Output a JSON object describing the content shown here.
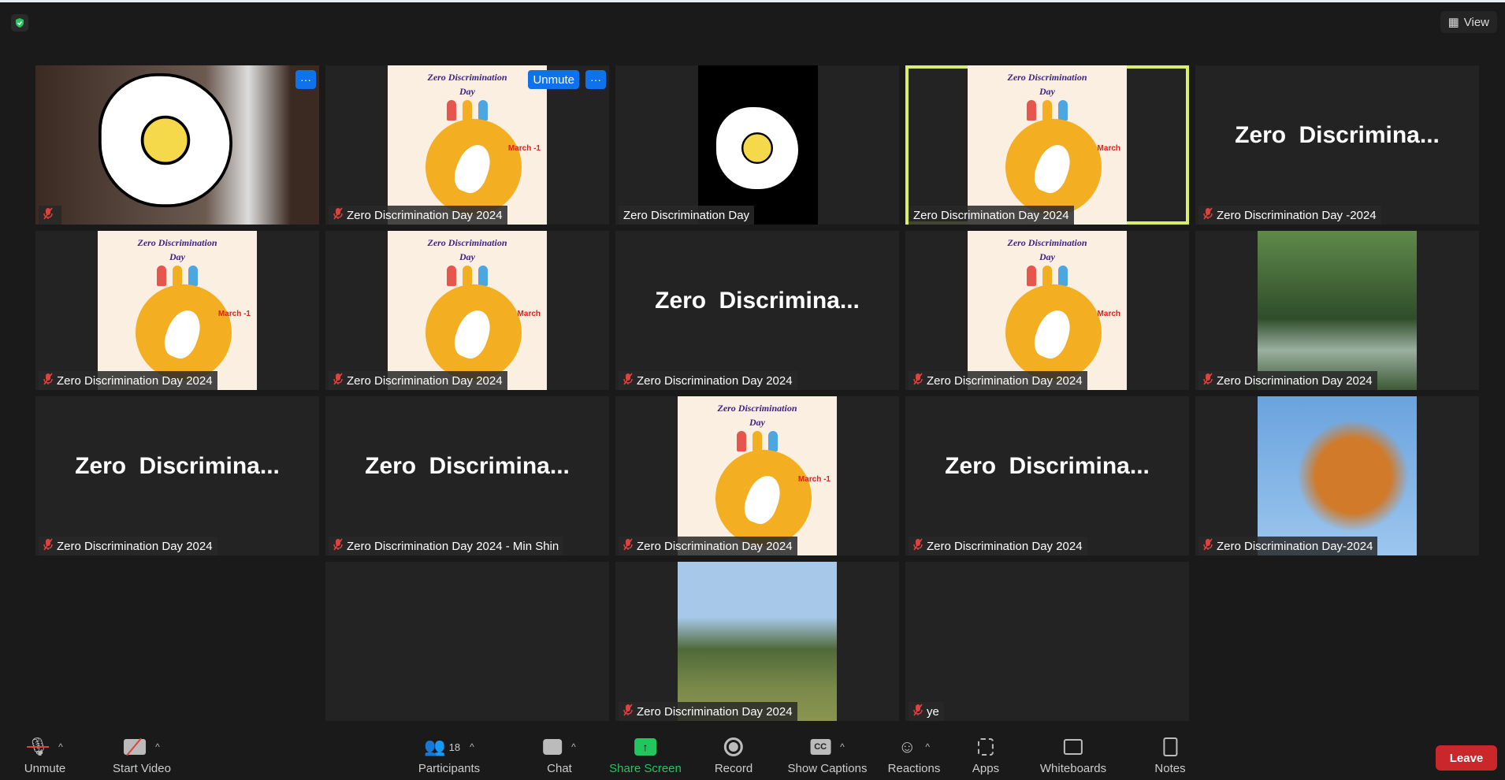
{
  "topbar": {
    "view_label": "View",
    "icons": {
      "security": "shield-check-icon",
      "view": "grid-icon"
    }
  },
  "colors": {
    "active_border": "#d9ef6a",
    "muted": "#e0413a",
    "share": "#22c55e",
    "leave": "#c9272a",
    "button_blue": "#0e72ed"
  },
  "tiles": [
    {
      "type": "flowercam",
      "name": "",
      "muted": true,
      "more": true
    },
    {
      "type": "poster",
      "name": "Zero Discrimination Day 2024",
      "muted": true,
      "unmute_button": "Unmute",
      "more": true,
      "march": "March -1"
    },
    {
      "type": "flowerblk",
      "name": "Zero Discrimination Day",
      "muted": false
    },
    {
      "type": "poster",
      "name": "Zero Discrimination Day 2024",
      "muted": false,
      "active": true,
      "march": "March"
    },
    {
      "type": "text",
      "big": "Zero  Discrimina...",
      "name": "Zero Discrimination Day -2024",
      "muted": true
    },
    {
      "type": "poster",
      "name": "Zero Discrimination Day 2024",
      "muted": true,
      "march": "March -1"
    },
    {
      "type": "poster",
      "name": "Zero Discrimination Day 2024",
      "muted": true,
      "march": "March"
    },
    {
      "type": "text",
      "big": "Zero  Discrimina...",
      "name": "Zero Discrimination Day 2024",
      "muted": true
    },
    {
      "type": "poster",
      "name": "Zero Discrimination Day 2024",
      "muted": true,
      "march": "March"
    },
    {
      "type": "forest",
      "name": "Zero Discrimination Day 2024",
      "muted": true
    },
    {
      "type": "text",
      "big": "Zero  Discrimina...",
      "name": "Zero Discrimination Day 2024",
      "muted": true
    },
    {
      "type": "text",
      "big": "Zero  Discrimina...",
      "name": "Zero Discrimination Day 2024 - Min Shin",
      "muted": true
    },
    {
      "type": "poster",
      "name": "Zero Discrimination Day 2024",
      "muted": true,
      "march": "March -1"
    },
    {
      "type": "text",
      "big": "Zero  Discrimina...",
      "name": "Zero Discrimination Day 2024",
      "muted": true
    },
    {
      "type": "flowers",
      "name": "Zero Discrimination Day-2024",
      "muted": true
    },
    {
      "type": "empty"
    },
    {
      "type": "blank",
      "name": "",
      "muted": false
    },
    {
      "type": "palms",
      "name": "Zero Discrimination Day 2024",
      "muted": true
    },
    {
      "type": "blank",
      "name": "ye",
      "muted": true
    }
  ],
  "poster_text": {
    "title": "Zero Discrimination",
    "day": "Day"
  },
  "more_label": "···",
  "toolbar": {
    "unmute": "Unmute",
    "start_video": "Start Video",
    "participants": "Participants",
    "participants_count": "18",
    "chat": "Chat",
    "share_screen": "Share Screen",
    "record": "Record",
    "captions": "Show Captions",
    "captions_badge": "CC",
    "reactions": "Reactions",
    "apps": "Apps",
    "whiteboards": "Whiteboards",
    "notes": "Notes",
    "leave": "Leave"
  }
}
